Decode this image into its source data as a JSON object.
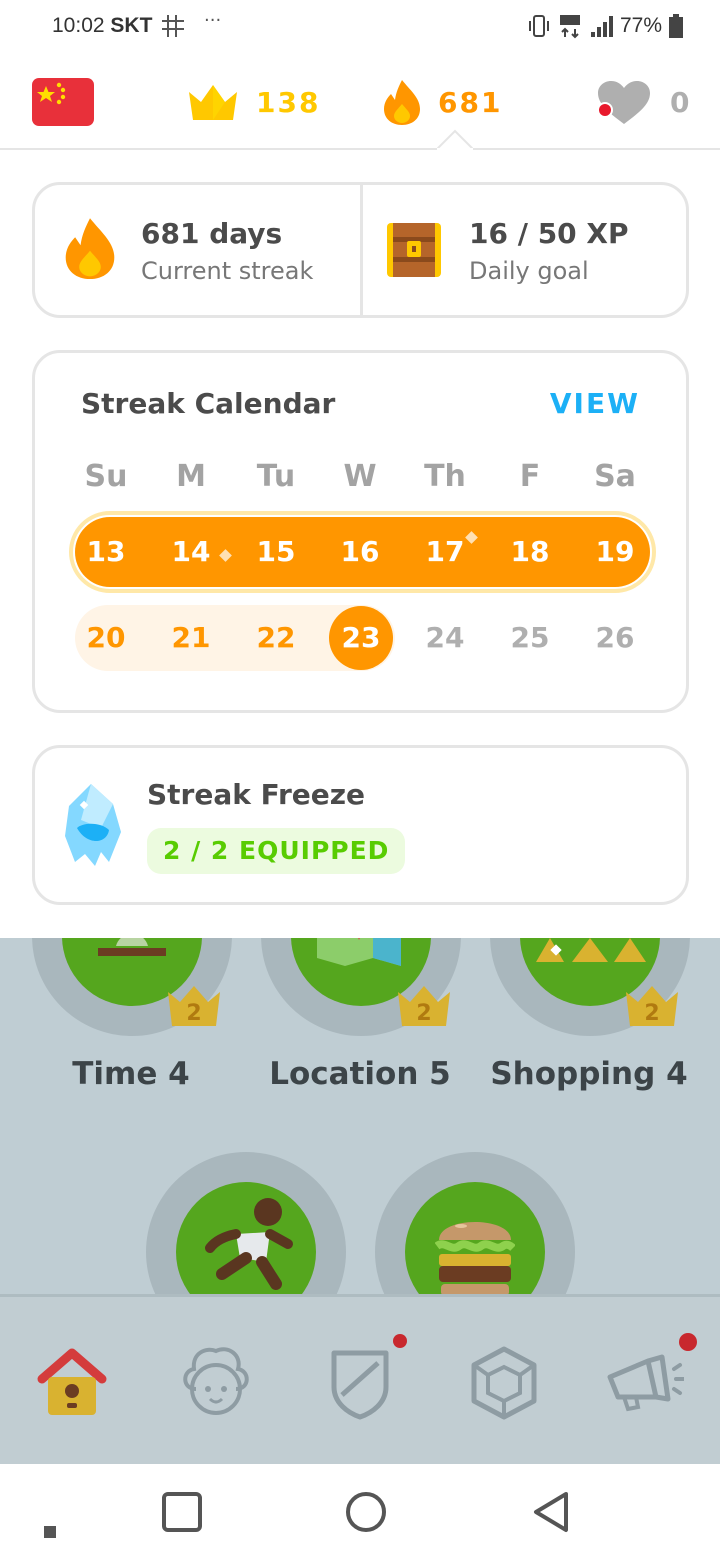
{
  "status_bar": {
    "time": "10:02",
    "carrier": "SKT",
    "battery": "77%",
    "icons": [
      "grid-icon",
      "more-dots-icon",
      "vibrate-icon",
      "lte-icon",
      "signal-icon",
      "battery-icon"
    ]
  },
  "topbar": {
    "language_flag": "china-flag-icon",
    "crowns": "138",
    "streak": "681",
    "hearts": "0"
  },
  "streak_summary": {
    "streak_title": "681 days",
    "streak_sub": "Current streak",
    "goal_title": "16 / 50 XP",
    "goal_sub": "Daily goal"
  },
  "calendar": {
    "title": "Streak Calendar",
    "view_label": "VIEW",
    "weekdays": [
      "Su",
      "M",
      "Tu",
      "W",
      "Th",
      "F",
      "Sa"
    ],
    "week1": [
      "13",
      "14",
      "15",
      "16",
      "17",
      "18",
      "19"
    ],
    "week2": [
      "20",
      "21",
      "22",
      "23",
      "24",
      "25",
      "26"
    ],
    "today": "23"
  },
  "freeze": {
    "title": "Streak Freeze",
    "badge": "2 / 2 EQUIPPED"
  },
  "skills": [
    {
      "label": "Time 4",
      "level": "2"
    },
    {
      "label": "Location 5",
      "level": "2"
    },
    {
      "label": "Shopping 4",
      "level": "2"
    }
  ],
  "colors": {
    "streak_orange": "#ff9600",
    "crown_yellow": "#ffc800",
    "link_blue": "#1cb0f6",
    "success_green": "#58cc02"
  },
  "bottom_nav": [
    "home-icon",
    "characters-icon",
    "leagues-shield-icon",
    "shop-gem-icon",
    "news-megaphone-icon"
  ]
}
